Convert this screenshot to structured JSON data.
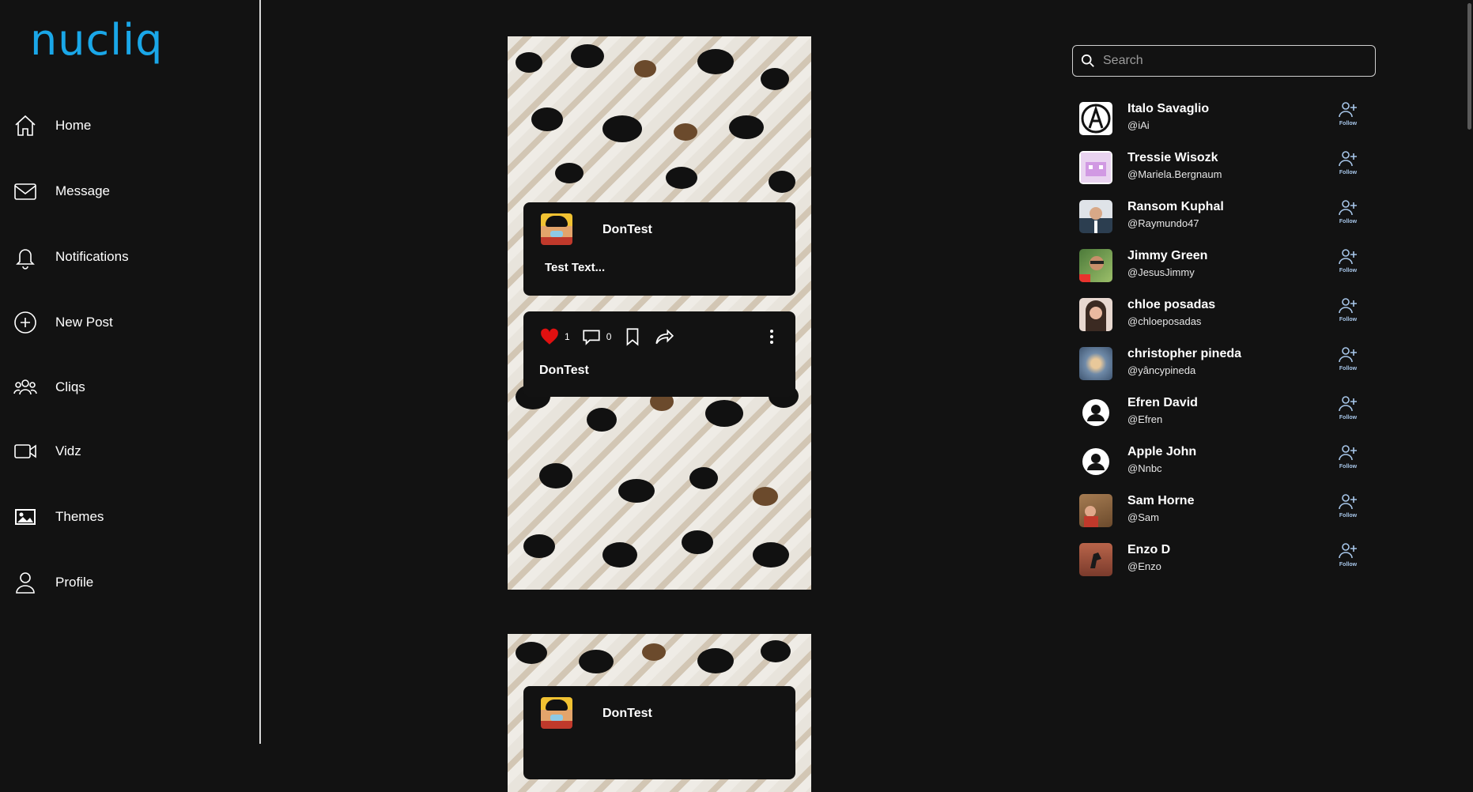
{
  "brand": {
    "logo_text": "nucliq",
    "accent": "#1aa7e8"
  },
  "nav": [
    {
      "label": "Home",
      "icon": "home-icon"
    },
    {
      "label": "Message",
      "icon": "mail-icon"
    },
    {
      "label": "Notifications",
      "icon": "bell-icon"
    },
    {
      "label": "New Post",
      "icon": "plus-circle-icon"
    },
    {
      "label": "Cliqs",
      "icon": "group-icon"
    },
    {
      "label": "Vidz",
      "icon": "video-icon"
    },
    {
      "label": "Themes",
      "icon": "image-icon"
    },
    {
      "label": "Profile",
      "icon": "user-icon"
    }
  ],
  "feed": {
    "posts": [
      {
        "username": "DonTest",
        "text": "Test Text...",
        "likes": "1",
        "comments": "0",
        "liked": true,
        "footer_user": "DonTest"
      },
      {
        "username": "DonTest"
      }
    ]
  },
  "search": {
    "placeholder": "Search"
  },
  "suggestions": {
    "follow_label": "Follow",
    "users": [
      {
        "name": "Italo Savaglio",
        "handle": "@iAi"
      },
      {
        "name": "Tressie Wisozk",
        "handle": "@Mariela.Bergnaum"
      },
      {
        "name": "Ransom Kuphal",
        "handle": "@Raymundo47"
      },
      {
        "name": "Jimmy Green",
        "handle": "@JesusJimmy"
      },
      {
        "name": "chloe posadas",
        "handle": "@chloeposadas"
      },
      {
        "name": "christopher pineda",
        "handle": "@yâncypineda"
      },
      {
        "name": "Efren David",
        "handle": "@Efren"
      },
      {
        "name": "Apple John",
        "handle": "@Nnbc"
      },
      {
        "name": "Sam Horne",
        "handle": "@Sam"
      },
      {
        "name": "Enzo D",
        "handle": "@Enzo"
      }
    ]
  }
}
